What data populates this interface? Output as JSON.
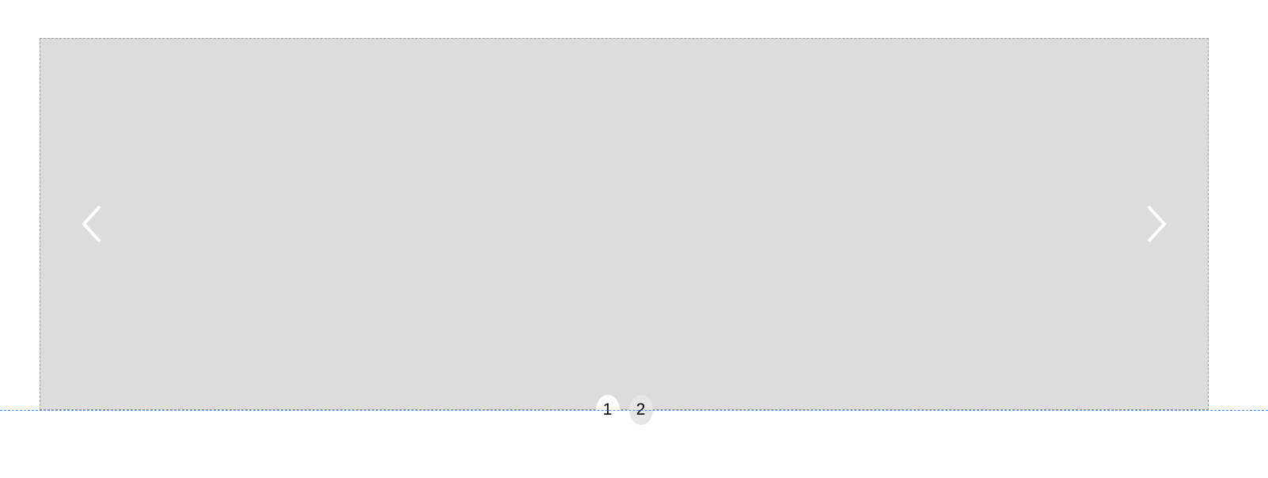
{
  "carousel": {
    "pages": [
      {
        "label": "1",
        "active": true
      },
      {
        "label": "2",
        "active": false
      }
    ]
  }
}
